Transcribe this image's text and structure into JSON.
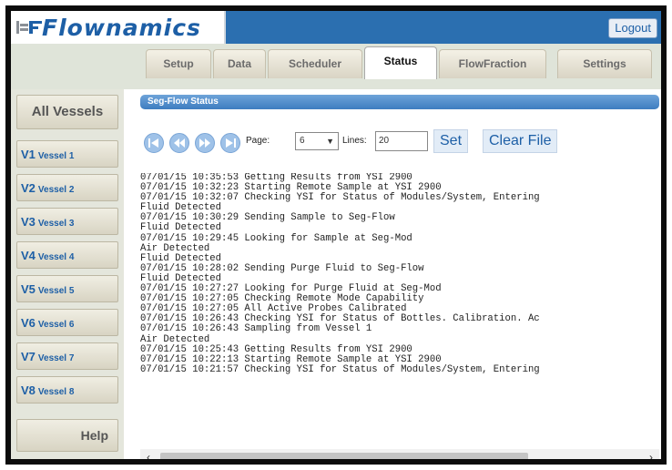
{
  "app": {
    "brand": "Flownamics",
    "logout_label": "Logout"
  },
  "tabs": [
    {
      "label": "Setup",
      "active": false
    },
    {
      "label": "Data",
      "active": false
    },
    {
      "label": "Scheduler",
      "active": false
    },
    {
      "label": "Status",
      "active": true
    },
    {
      "label": "FlowFraction",
      "active": false
    },
    {
      "label": "Settings",
      "active": false
    }
  ],
  "sidebar": {
    "all_label": "All Vessels",
    "vessels": [
      {
        "code": "V1",
        "label": "Vessel 1"
      },
      {
        "code": "V2",
        "label": "Vessel 2"
      },
      {
        "code": "V3",
        "label": "Vessel 3"
      },
      {
        "code": "V4",
        "label": "Vessel 4"
      },
      {
        "code": "V5",
        "label": "Vessel 5"
      },
      {
        "code": "V6",
        "label": "Vessel 6"
      },
      {
        "code": "V7",
        "label": "Vessel 7"
      },
      {
        "code": "V8",
        "label": "Vessel 8"
      }
    ],
    "help_label": "Help"
  },
  "status_panel": {
    "title": "Seg-Flow Status",
    "page_label": "Page:",
    "page_value": "6",
    "lines_label": "Lines:",
    "lines_value": "20",
    "set_label": "Set",
    "clear_label": "Clear File",
    "log_lines": [
      "07/01/15 10:35:53 Getting Results from YSI 2900",
      "07/01/15 10:32:23 Starting Remote Sample at YSI 2900",
      "07/01/15 10:32:07 Checking YSI for Status of Modules/System, Entering",
      "Fluid Detected",
      "07/01/15 10:30:29 Sending Sample to Seg-Flow",
      "Fluid Detected",
      "07/01/15 10:29:45 Looking for Sample at Seg-Mod",
      "Air Detected",
      "Fluid Detected",
      "07/01/15 10:28:02 Sending Purge Fluid to Seg-Flow",
      "Fluid Detected",
      "07/01/15 10:27:27 Looking for Purge Fluid at Seg-Mod",
      "07/01/15 10:27:05 Checking Remote Mode Capability",
      "07/01/15 10:27:05 All Active Probes Calibrated",
      "07/01/15 10:26:43 Checking YSI for Status of Bottles. Calibration. Ac",
      "07/01/15 10:26:43 Sampling from Vessel 1",
      "Air Detected",
      "07/01/15 10:25:43 Getting Results from YSI 2900",
      "07/01/15 10:22:13 Starting Remote Sample at YSI 2900",
      "07/01/15 10:21:57 Checking YSI for Status of Modules/System, Entering"
    ],
    "scroll_position": 0.02
  },
  "colors": {
    "header_blue": "#2b6fb0",
    "brand_blue": "#1d5fa6",
    "nav_button": "#9fc2e8",
    "panel_title": "#3d7dc0"
  },
  "icons": {
    "first": "skip-first-icon",
    "prev": "rewind-icon",
    "next": "fast-forward-icon",
    "last": "skip-last-icon"
  }
}
